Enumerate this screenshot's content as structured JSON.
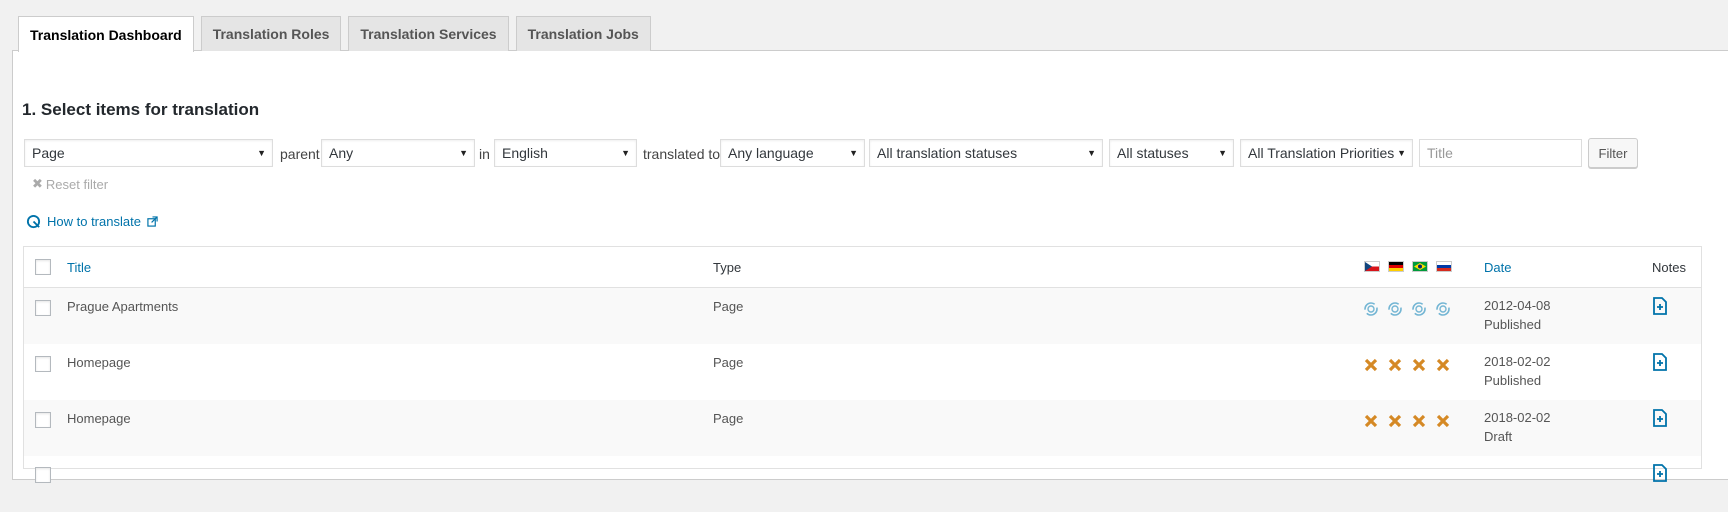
{
  "tabs": [
    {
      "label": "Translation Dashboard",
      "active": true
    },
    {
      "label": "Translation Roles",
      "active": false
    },
    {
      "label": "Translation Services",
      "active": false
    },
    {
      "label": "Translation Jobs",
      "active": false
    }
  ],
  "section_title": "1. Select items for translation",
  "filters": {
    "type": "Page",
    "parent_label": "parent",
    "parent": "Any",
    "in_label": "in",
    "language": "English",
    "translated_to_label": "translated to",
    "target_language": "Any language",
    "translation_status": "All translation statuses",
    "status": "All statuses",
    "priority": "All Translation Priorities",
    "title_placeholder": "Title",
    "filter_button": "Filter",
    "reset_filter": "Reset filter"
  },
  "how_to_translate": "How to translate",
  "table": {
    "columns": {
      "title": "Title",
      "type": "Type",
      "date": "Date",
      "notes": "Notes"
    },
    "language_flags": [
      "cz-flag",
      "de-flag",
      "br-flag",
      "ru-flag"
    ],
    "rows": [
      {
        "title": "Prague Apartments",
        "type": "Page",
        "date": "2012-04-08",
        "status": "Published",
        "lang_status": "needs-update"
      },
      {
        "title": "Homepage",
        "type": "Page",
        "date": "2018-02-02",
        "status": "Published",
        "lang_status": "not-translated"
      },
      {
        "title": "Homepage",
        "type": "Page",
        "date": "2018-02-02",
        "status": "Draft",
        "lang_status": "not-translated"
      }
    ]
  },
  "colors": {
    "link": "#0073aa",
    "not_translated": "#d58925",
    "needs_update": "#74b6d4"
  }
}
